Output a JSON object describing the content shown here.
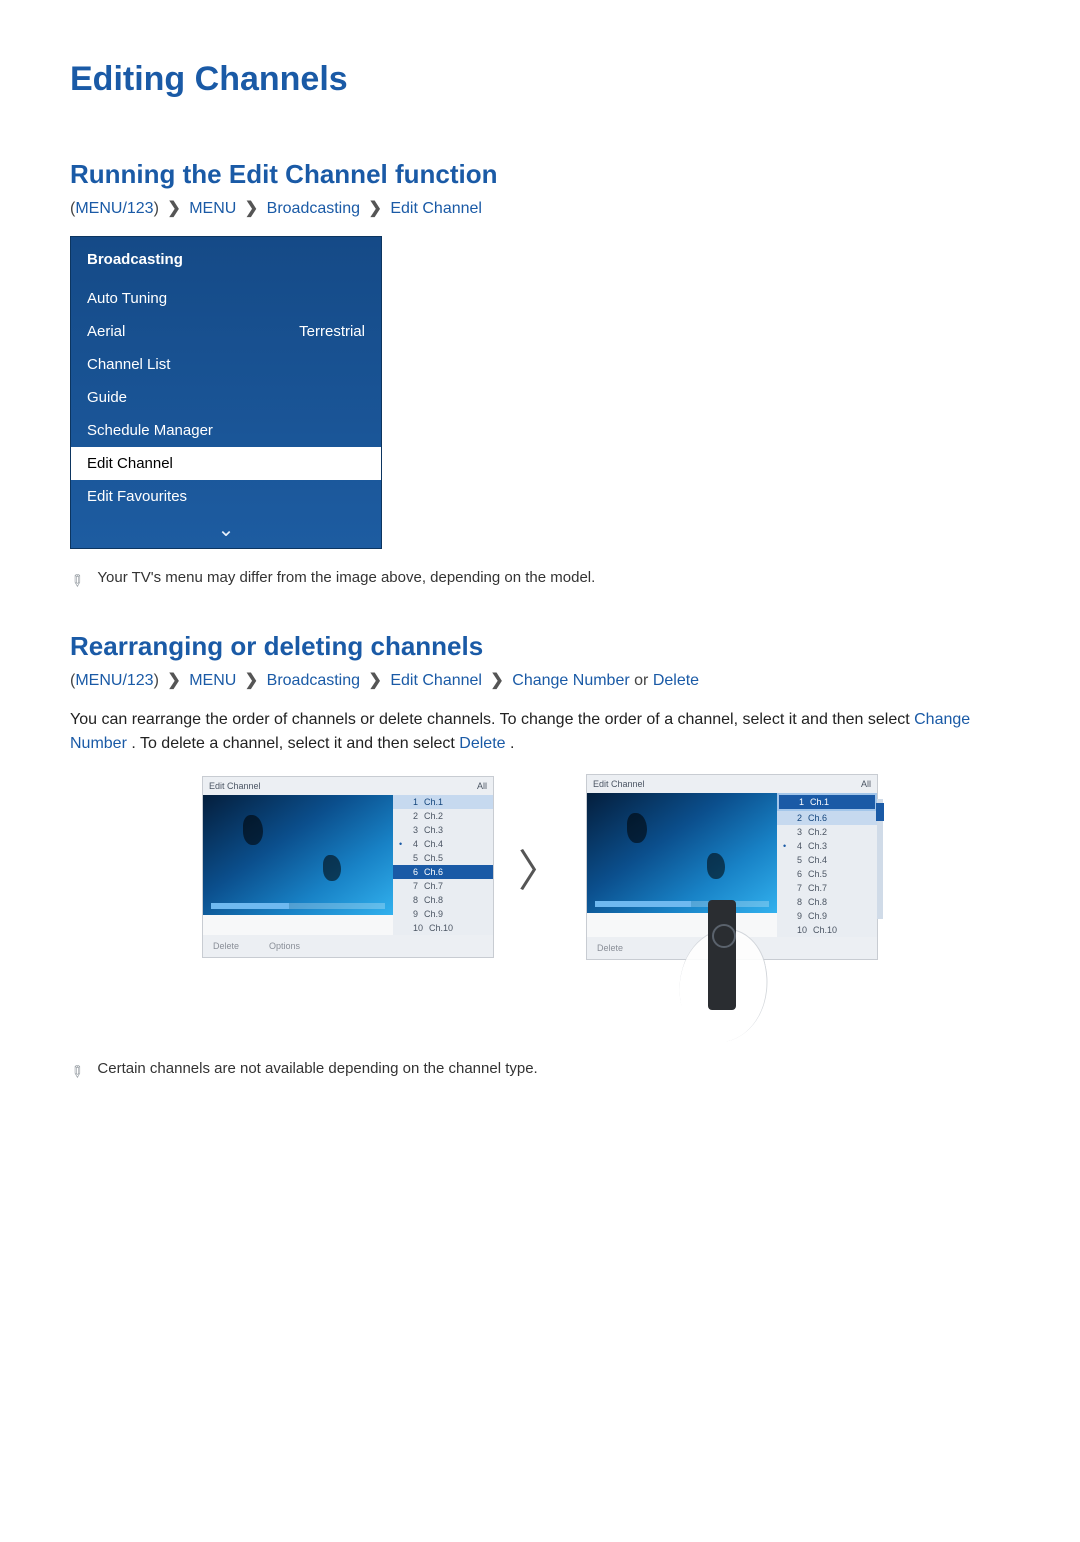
{
  "page_title": "Editing Channels",
  "section1": {
    "title": "Running the Edit Channel function",
    "nav": {
      "prefix": "(",
      "root": "MENU/123",
      "suffix": ")",
      "parts": [
        "MENU",
        "Broadcasting",
        "Edit Channel"
      ]
    }
  },
  "bc_menu": {
    "header": "Broadcasting",
    "rows": [
      {
        "label": "Auto Tuning",
        "value": ""
      },
      {
        "label": "Aerial",
        "value": "Terrestrial"
      },
      {
        "label": "Channel List",
        "value": ""
      },
      {
        "label": "Guide",
        "value": ""
      },
      {
        "label": "Schedule Manager",
        "value": ""
      },
      {
        "label": "Edit Channel",
        "value": "",
        "selected": true
      },
      {
        "label": "Edit Favourites",
        "value": ""
      }
    ]
  },
  "note1": "Your TV's menu may differ from the image above, depending on the model.",
  "section2": {
    "title": "Rearranging or deleting channels",
    "nav": {
      "prefix": "(",
      "root": "MENU/123",
      "suffix": ")",
      "parts": [
        "MENU",
        "Broadcasting",
        "Edit Channel",
        "Change Number"
      ],
      "or_word": " or ",
      "or_target": "Delete"
    },
    "body_parts": [
      "You can rearrange the order of channels or delete channels. To change the order of a channel, select it and then select ",
      "Change Number",
      ". To delete a channel, select it and then select ",
      "Delete",
      "."
    ]
  },
  "shot_left": {
    "title": "Edit Channel",
    "tab": "All",
    "progress_pct": 45,
    "selected_index": 5,
    "secondary_index": 0,
    "mark_index": 3,
    "channels": [
      {
        "n": "1",
        "name": "Ch.1"
      },
      {
        "n": "2",
        "name": "Ch.2"
      },
      {
        "n": "3",
        "name": "Ch.3"
      },
      {
        "n": "4",
        "name": "Ch.4"
      },
      {
        "n": "5",
        "name": "Ch.5"
      },
      {
        "n": "6",
        "name": "Ch.6"
      },
      {
        "n": "7",
        "name": "Ch.7"
      },
      {
        "n": "8",
        "name": "Ch.8"
      },
      {
        "n": "9",
        "name": "Ch.9"
      },
      {
        "n": "10",
        "name": "Ch.10"
      }
    ],
    "footer": [
      "Delete",
      "Options"
    ]
  },
  "shot_right": {
    "title": "Edit Channel",
    "tab": "All",
    "progress_pct": 55,
    "selected_index": 0,
    "secondary_index": 1,
    "mark_index": 3,
    "channels": [
      {
        "n": "1",
        "name": "Ch.1"
      },
      {
        "n": "2",
        "name": "Ch.6"
      },
      {
        "n": "3",
        "name": "Ch.2"
      },
      {
        "n": "4",
        "name": "Ch.3"
      },
      {
        "n": "5",
        "name": "Ch.4"
      },
      {
        "n": "6",
        "name": "Ch.5"
      },
      {
        "n": "7",
        "name": "Ch.7"
      },
      {
        "n": "8",
        "name": "Ch.8"
      },
      {
        "n": "9",
        "name": "Ch.9"
      },
      {
        "n": "10",
        "name": "Ch.10"
      }
    ],
    "footer": [
      "Delete"
    ]
  },
  "note2": "Certain channels are not available depending on the channel type."
}
